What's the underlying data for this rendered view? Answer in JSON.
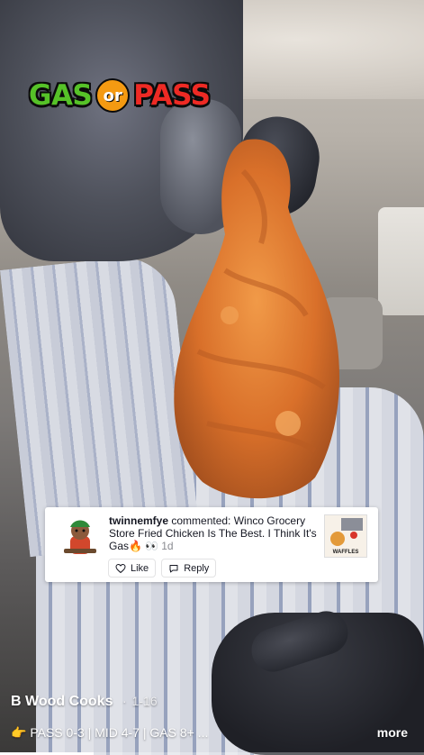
{
  "overlay": {
    "logo": {
      "gas": "GAS",
      "or": "or",
      "pass": "PASS"
    }
  },
  "comment_card": {
    "username": "twinnemfye",
    "action": "commented:",
    "text": "Winco Grocery Store Fried Chicken Is The Best. I Think It's Gas",
    "emojis": "🔥 👀",
    "time": "1d",
    "like_label": "Like",
    "reply_label": "Reply",
    "thumbnail_text": "WAFFLES"
  },
  "caption": {
    "author": "B Wood Cooks",
    "separator": "·",
    "date": "1-16",
    "text": "👉 PASS 0-3 | MID 4-7 | GAS 8+ ...",
    "more_label": "more"
  },
  "progress": {
    "fraction": 0.22
  },
  "colors": {
    "gas_green": "#56c228",
    "pass_red": "#ee2a24",
    "or_orange": "#f49a12",
    "chicken_orange": "#e0782a"
  }
}
